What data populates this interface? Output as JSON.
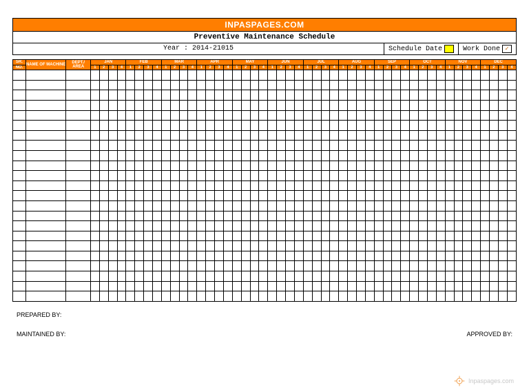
{
  "header": {
    "site": "INPASPAGES.COM",
    "title": "Preventive Maintenance Schedule",
    "year_label": "Year : 2014-21015",
    "legend": {
      "schedule": "Schedule Date",
      "work_done": "Work Done",
      "check": "✓"
    }
  },
  "columns": {
    "sr_top": "SR.",
    "sr_bot": "NO.",
    "name": "NAME OF MACHINE",
    "dept": "DEPT./ AREA"
  },
  "months": [
    "JAN",
    "FEB",
    "MAR",
    "APR",
    "MAY",
    "JUN",
    "JUL",
    "AUG",
    "SEP",
    "OCT",
    "NOV",
    "DEC"
  ],
  "weeks": [
    "1",
    "2",
    "3",
    "4"
  ],
  "body_rows": 23,
  "signatures": {
    "prepared": "PREPARED BY:",
    "maintained": "MAINTAINED BY:",
    "approved": "APPROVED BY:"
  },
  "watermark": "Inpaspages.com"
}
